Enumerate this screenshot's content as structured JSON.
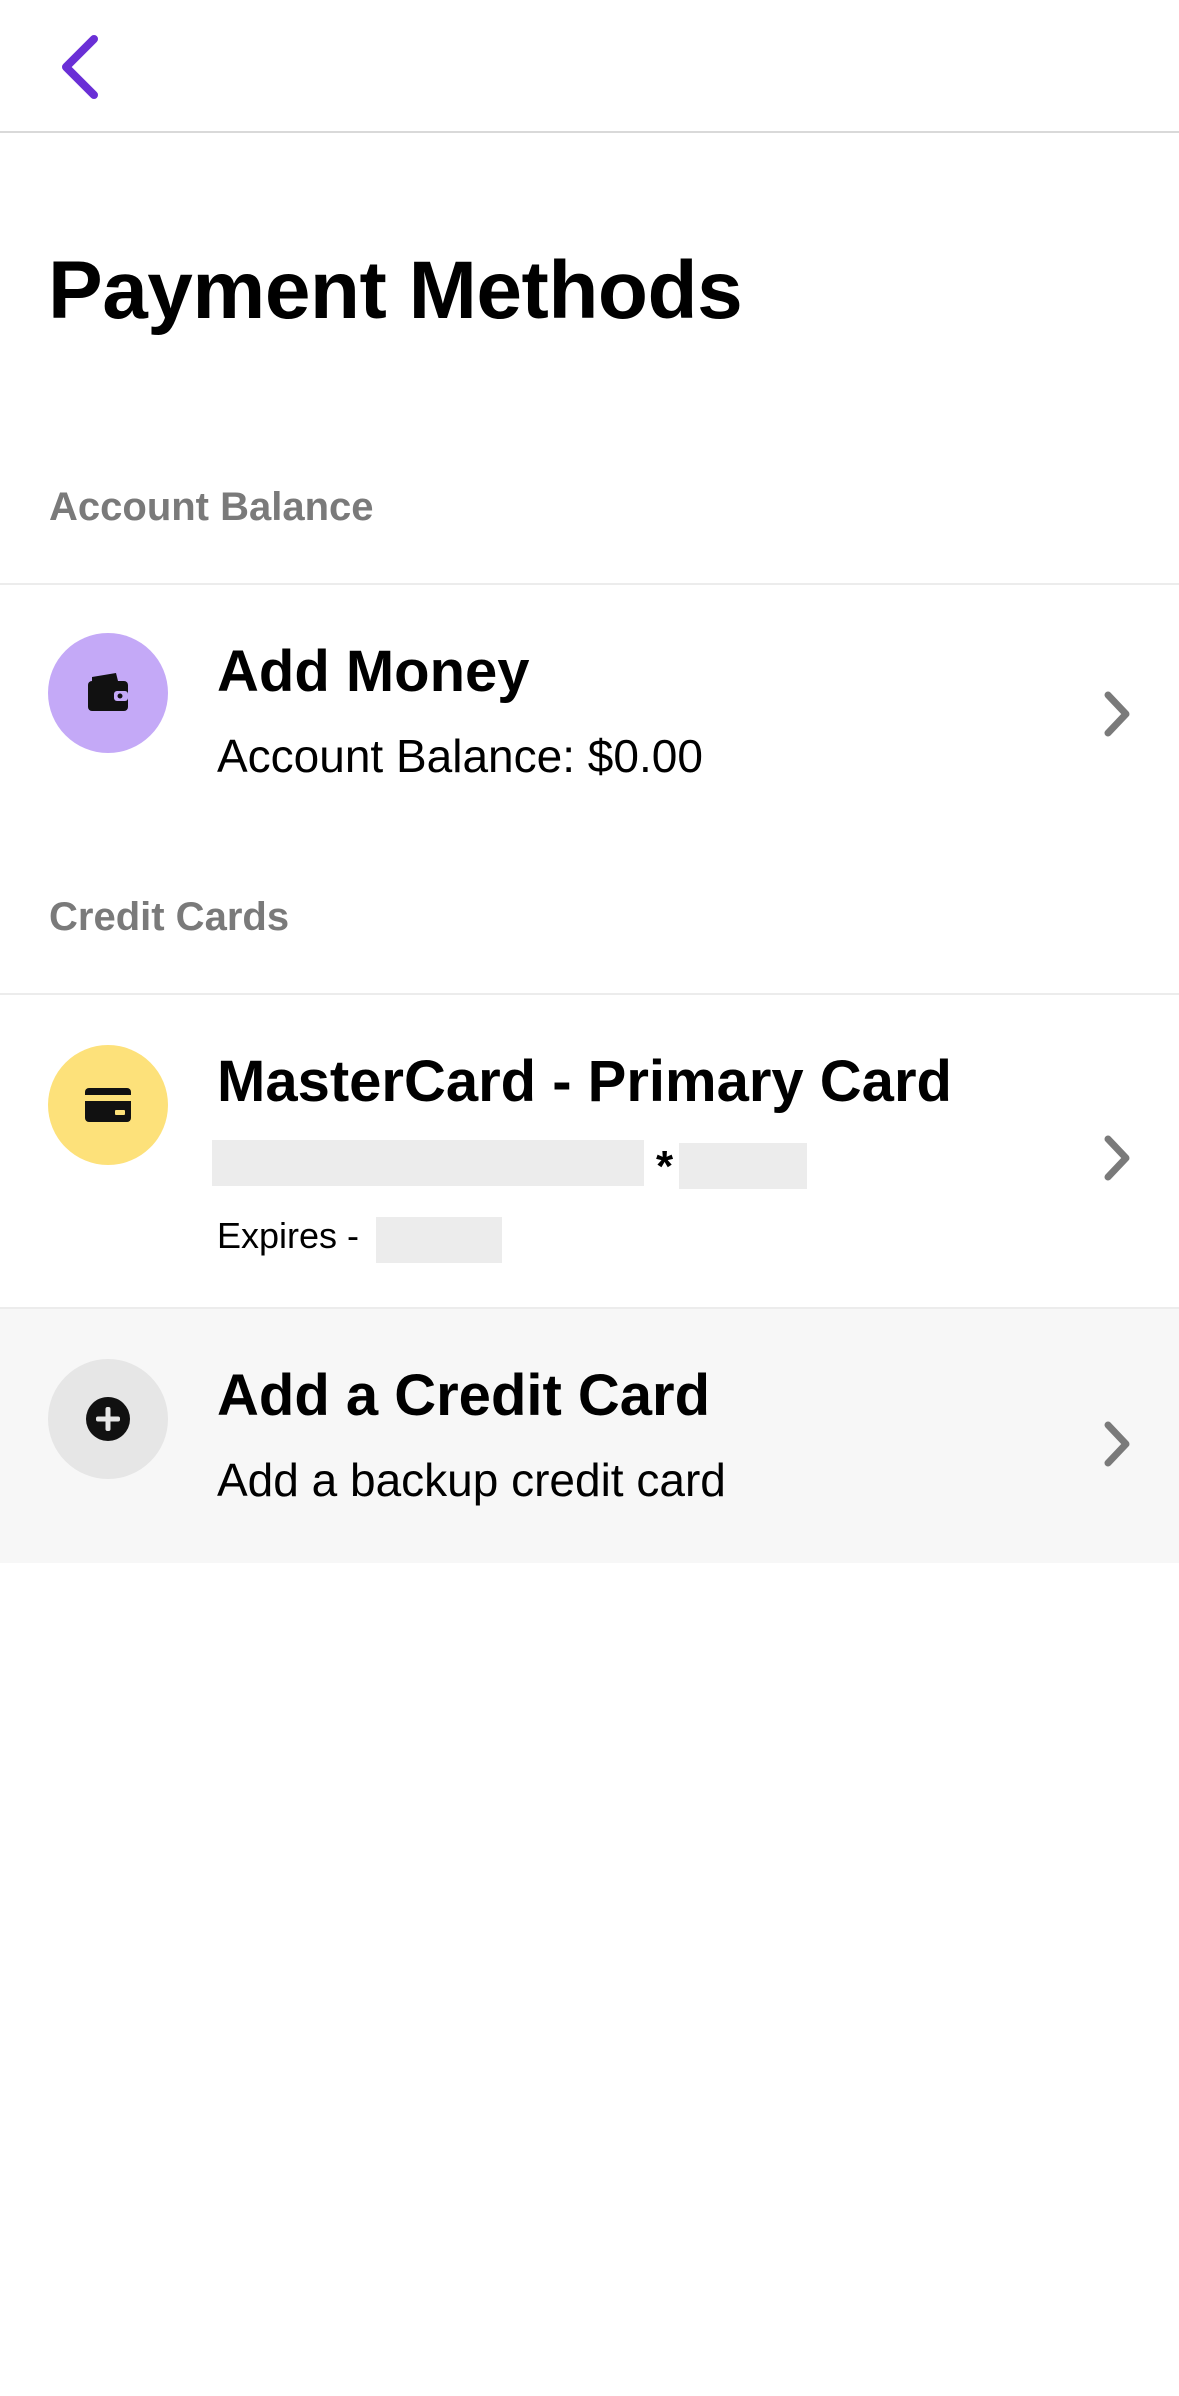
{
  "header": {
    "back_icon": "chevron-left-icon",
    "accent_color": "#6a2fd6"
  },
  "page_title": "Payment Methods",
  "account_balance_section": {
    "header": "Account Balance",
    "add_money": {
      "icon": "wallet-icon",
      "icon_bg": "#c4a9f7",
      "title": "Add Money",
      "subtitle": "Account Balance: $0.00"
    }
  },
  "credit_cards_section": {
    "header": "Credit Cards",
    "cards": [
      {
        "icon": "credit-card-icon",
        "icon_bg": "#fde17a",
        "title": "MasterCard - Primary Card",
        "number_separator": "*",
        "expires_label": "Expires -"
      }
    ],
    "add_card": {
      "icon": "plus-circle-icon",
      "icon_bg": "#e6e6e6",
      "title": "Add a Credit Card",
      "subtitle": "Add a backup credit card"
    }
  }
}
